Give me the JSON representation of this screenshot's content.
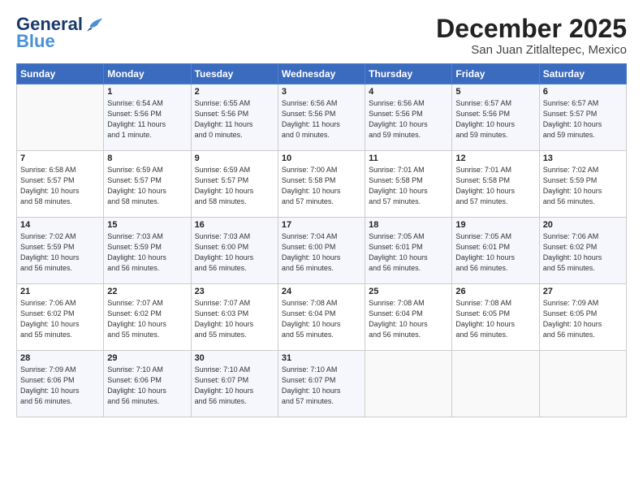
{
  "logo": {
    "line1": "General",
    "line2": "Blue"
  },
  "title": "December 2025",
  "location": "San Juan Zitlaltepec, Mexico",
  "headers": [
    "Sunday",
    "Monday",
    "Tuesday",
    "Wednesday",
    "Thursday",
    "Friday",
    "Saturday"
  ],
  "weeks": [
    [
      {
        "day": "",
        "info": ""
      },
      {
        "day": "1",
        "info": "Sunrise: 6:54 AM\nSunset: 5:56 PM\nDaylight: 11 hours\nand 1 minute."
      },
      {
        "day": "2",
        "info": "Sunrise: 6:55 AM\nSunset: 5:56 PM\nDaylight: 11 hours\nand 0 minutes."
      },
      {
        "day": "3",
        "info": "Sunrise: 6:56 AM\nSunset: 5:56 PM\nDaylight: 11 hours\nand 0 minutes."
      },
      {
        "day": "4",
        "info": "Sunrise: 6:56 AM\nSunset: 5:56 PM\nDaylight: 10 hours\nand 59 minutes."
      },
      {
        "day": "5",
        "info": "Sunrise: 6:57 AM\nSunset: 5:56 PM\nDaylight: 10 hours\nand 59 minutes."
      },
      {
        "day": "6",
        "info": "Sunrise: 6:57 AM\nSunset: 5:57 PM\nDaylight: 10 hours\nand 59 minutes."
      }
    ],
    [
      {
        "day": "7",
        "info": "Sunrise: 6:58 AM\nSunset: 5:57 PM\nDaylight: 10 hours\nand 58 minutes."
      },
      {
        "day": "8",
        "info": "Sunrise: 6:59 AM\nSunset: 5:57 PM\nDaylight: 10 hours\nand 58 minutes."
      },
      {
        "day": "9",
        "info": "Sunrise: 6:59 AM\nSunset: 5:57 PM\nDaylight: 10 hours\nand 58 minutes."
      },
      {
        "day": "10",
        "info": "Sunrise: 7:00 AM\nSunset: 5:58 PM\nDaylight: 10 hours\nand 57 minutes."
      },
      {
        "day": "11",
        "info": "Sunrise: 7:01 AM\nSunset: 5:58 PM\nDaylight: 10 hours\nand 57 minutes."
      },
      {
        "day": "12",
        "info": "Sunrise: 7:01 AM\nSunset: 5:58 PM\nDaylight: 10 hours\nand 57 minutes."
      },
      {
        "day": "13",
        "info": "Sunrise: 7:02 AM\nSunset: 5:59 PM\nDaylight: 10 hours\nand 56 minutes."
      }
    ],
    [
      {
        "day": "14",
        "info": "Sunrise: 7:02 AM\nSunset: 5:59 PM\nDaylight: 10 hours\nand 56 minutes."
      },
      {
        "day": "15",
        "info": "Sunrise: 7:03 AM\nSunset: 5:59 PM\nDaylight: 10 hours\nand 56 minutes."
      },
      {
        "day": "16",
        "info": "Sunrise: 7:03 AM\nSunset: 6:00 PM\nDaylight: 10 hours\nand 56 minutes."
      },
      {
        "day": "17",
        "info": "Sunrise: 7:04 AM\nSunset: 6:00 PM\nDaylight: 10 hours\nand 56 minutes."
      },
      {
        "day": "18",
        "info": "Sunrise: 7:05 AM\nSunset: 6:01 PM\nDaylight: 10 hours\nand 56 minutes."
      },
      {
        "day": "19",
        "info": "Sunrise: 7:05 AM\nSunset: 6:01 PM\nDaylight: 10 hours\nand 56 minutes."
      },
      {
        "day": "20",
        "info": "Sunrise: 7:06 AM\nSunset: 6:02 PM\nDaylight: 10 hours\nand 55 minutes."
      }
    ],
    [
      {
        "day": "21",
        "info": "Sunrise: 7:06 AM\nSunset: 6:02 PM\nDaylight: 10 hours\nand 55 minutes."
      },
      {
        "day": "22",
        "info": "Sunrise: 7:07 AM\nSunset: 6:02 PM\nDaylight: 10 hours\nand 55 minutes."
      },
      {
        "day": "23",
        "info": "Sunrise: 7:07 AM\nSunset: 6:03 PM\nDaylight: 10 hours\nand 55 minutes."
      },
      {
        "day": "24",
        "info": "Sunrise: 7:08 AM\nSunset: 6:04 PM\nDaylight: 10 hours\nand 55 minutes."
      },
      {
        "day": "25",
        "info": "Sunrise: 7:08 AM\nSunset: 6:04 PM\nDaylight: 10 hours\nand 56 minutes."
      },
      {
        "day": "26",
        "info": "Sunrise: 7:08 AM\nSunset: 6:05 PM\nDaylight: 10 hours\nand 56 minutes."
      },
      {
        "day": "27",
        "info": "Sunrise: 7:09 AM\nSunset: 6:05 PM\nDaylight: 10 hours\nand 56 minutes."
      }
    ],
    [
      {
        "day": "28",
        "info": "Sunrise: 7:09 AM\nSunset: 6:06 PM\nDaylight: 10 hours\nand 56 minutes."
      },
      {
        "day": "29",
        "info": "Sunrise: 7:10 AM\nSunset: 6:06 PM\nDaylight: 10 hours\nand 56 minutes."
      },
      {
        "day": "30",
        "info": "Sunrise: 7:10 AM\nSunset: 6:07 PM\nDaylight: 10 hours\nand 56 minutes."
      },
      {
        "day": "31",
        "info": "Sunrise: 7:10 AM\nSunset: 6:07 PM\nDaylight: 10 hours\nand 57 minutes."
      },
      {
        "day": "",
        "info": ""
      },
      {
        "day": "",
        "info": ""
      },
      {
        "day": "",
        "info": ""
      }
    ]
  ]
}
